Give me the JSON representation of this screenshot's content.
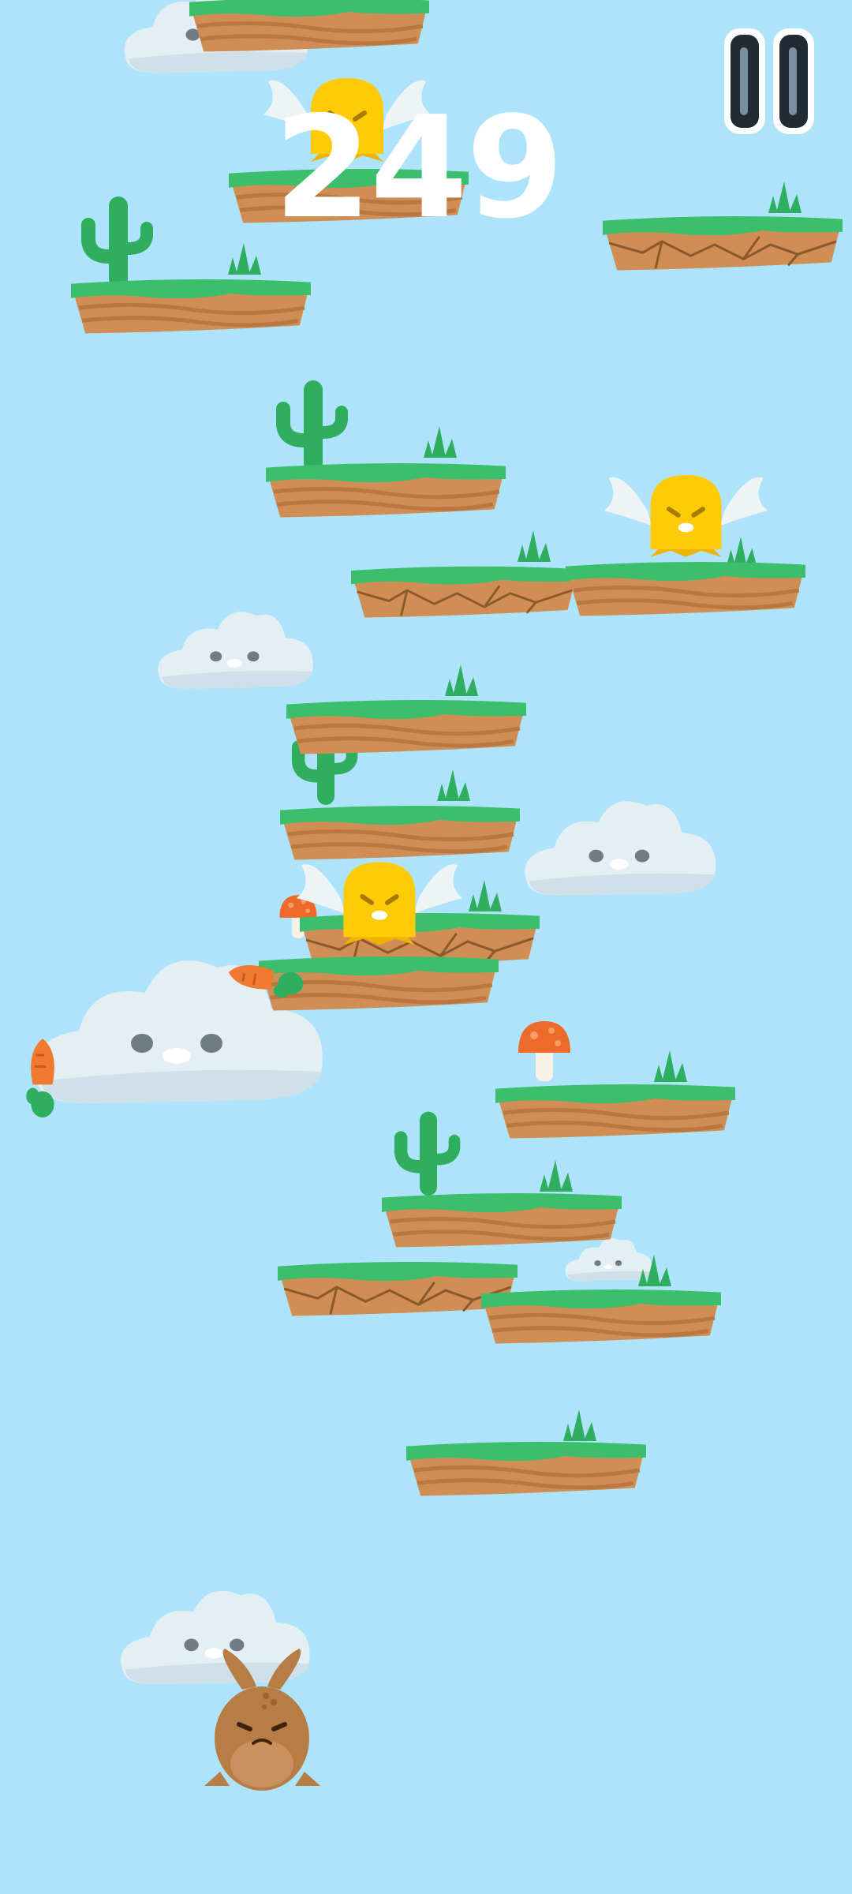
{
  "hud": {
    "score": "249",
    "pause_icon": "pause-icon"
  },
  "colors": {
    "sky": "#aee4fb",
    "grass": "#3dbe6c",
    "dirt": "#d08e54",
    "cactus": "#2fae60",
    "cloud": "#e4eff4",
    "bird": "#ffca08",
    "bunny": "#b87c45",
    "mushroom_cap": "#ee6a2a",
    "carrot": "#f07a2f"
  },
  "scene": {
    "platforms": [
      {
        "type": "normal"
      },
      {
        "type": "normal"
      },
      {
        "type": "cracked"
      },
      {
        "type": "normal"
      },
      {
        "type": "normal"
      },
      {
        "type": "cracked"
      },
      {
        "type": "normal"
      },
      {
        "type": "normal"
      },
      {
        "type": "normal"
      },
      {
        "type": "cracked"
      },
      {
        "type": "normal"
      },
      {
        "type": "normal"
      },
      {
        "type": "normal"
      },
      {
        "type": "cracked"
      },
      {
        "type": "normal"
      },
      {
        "type": "normal"
      }
    ],
    "enemies": [
      "winged-bird",
      "winged-bird",
      "winged-bird"
    ],
    "pickups": [
      "carrot",
      "carrot",
      "mushroom",
      "mushroom"
    ],
    "player": "bunny"
  }
}
